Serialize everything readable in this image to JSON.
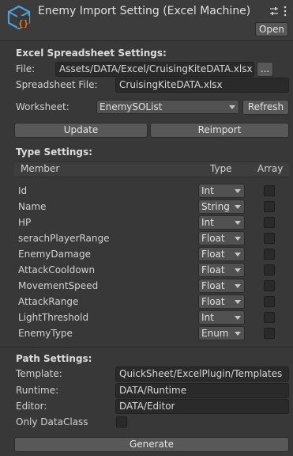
{
  "window": {
    "title": "Enemy Import Setting (Excel Machine)",
    "open_label": "Open",
    "header_icons": [
      "sliders-icon",
      "kebab-menu-icon"
    ]
  },
  "excel": {
    "section_title": "Excel Spreadsheet Settings:",
    "file_label": "File:",
    "file_value": "Assets/DATA/Excel/CruisingKiteDATA.xlsx",
    "browse_label": "...",
    "spreadsheet_label": "Spreadsheet File:",
    "spreadsheet_value": "CruisingKiteDATA.xlsx",
    "worksheet_label": "Worksheet:",
    "worksheet_value": "EnemySOList",
    "refresh_label": "Refresh",
    "update_label": "Update",
    "reimport_label": "Reimport"
  },
  "types": {
    "section_title": "Type Settings:",
    "col_member": "Member",
    "col_type": "Type",
    "col_array": "Array",
    "rows": [
      {
        "member": "Id",
        "type": "Int",
        "array": false
      },
      {
        "member": "Name",
        "type": "String",
        "array": false
      },
      {
        "member": "HP",
        "type": "Int",
        "array": false
      },
      {
        "member": "serachPlayerRange",
        "type": "Float",
        "array": false
      },
      {
        "member": "EnemyDamage",
        "type": "Float",
        "array": false
      },
      {
        "member": "AttackCooldown",
        "type": "Float",
        "array": false
      },
      {
        "member": "MovementSpeed",
        "type": "Float",
        "array": false
      },
      {
        "member": "AttackRange",
        "type": "Float",
        "array": false
      },
      {
        "member": "LightThreshold",
        "type": "Int",
        "array": false
      },
      {
        "member": "EnemyType",
        "type": "Enum",
        "array": false
      }
    ]
  },
  "paths": {
    "section_title": "Path Settings:",
    "template_label": "Template:",
    "template_value": "QuickSheet/ExcelPlugin/Templates",
    "runtime_label": "Runtime:",
    "runtime_value": "DATA/Runtime",
    "editor_label": "Editor:",
    "editor_value": "DATA/Editor",
    "only_dataclass_label": "Only DataClass",
    "only_dataclass_checked": false
  },
  "generate_label": "Generate",
  "colors": {
    "background": "#383838",
    "field": "#2a2a2a",
    "button": "#585858",
    "icon_blue": "#4aa3df",
    "icon_orange": "#e8772e"
  }
}
